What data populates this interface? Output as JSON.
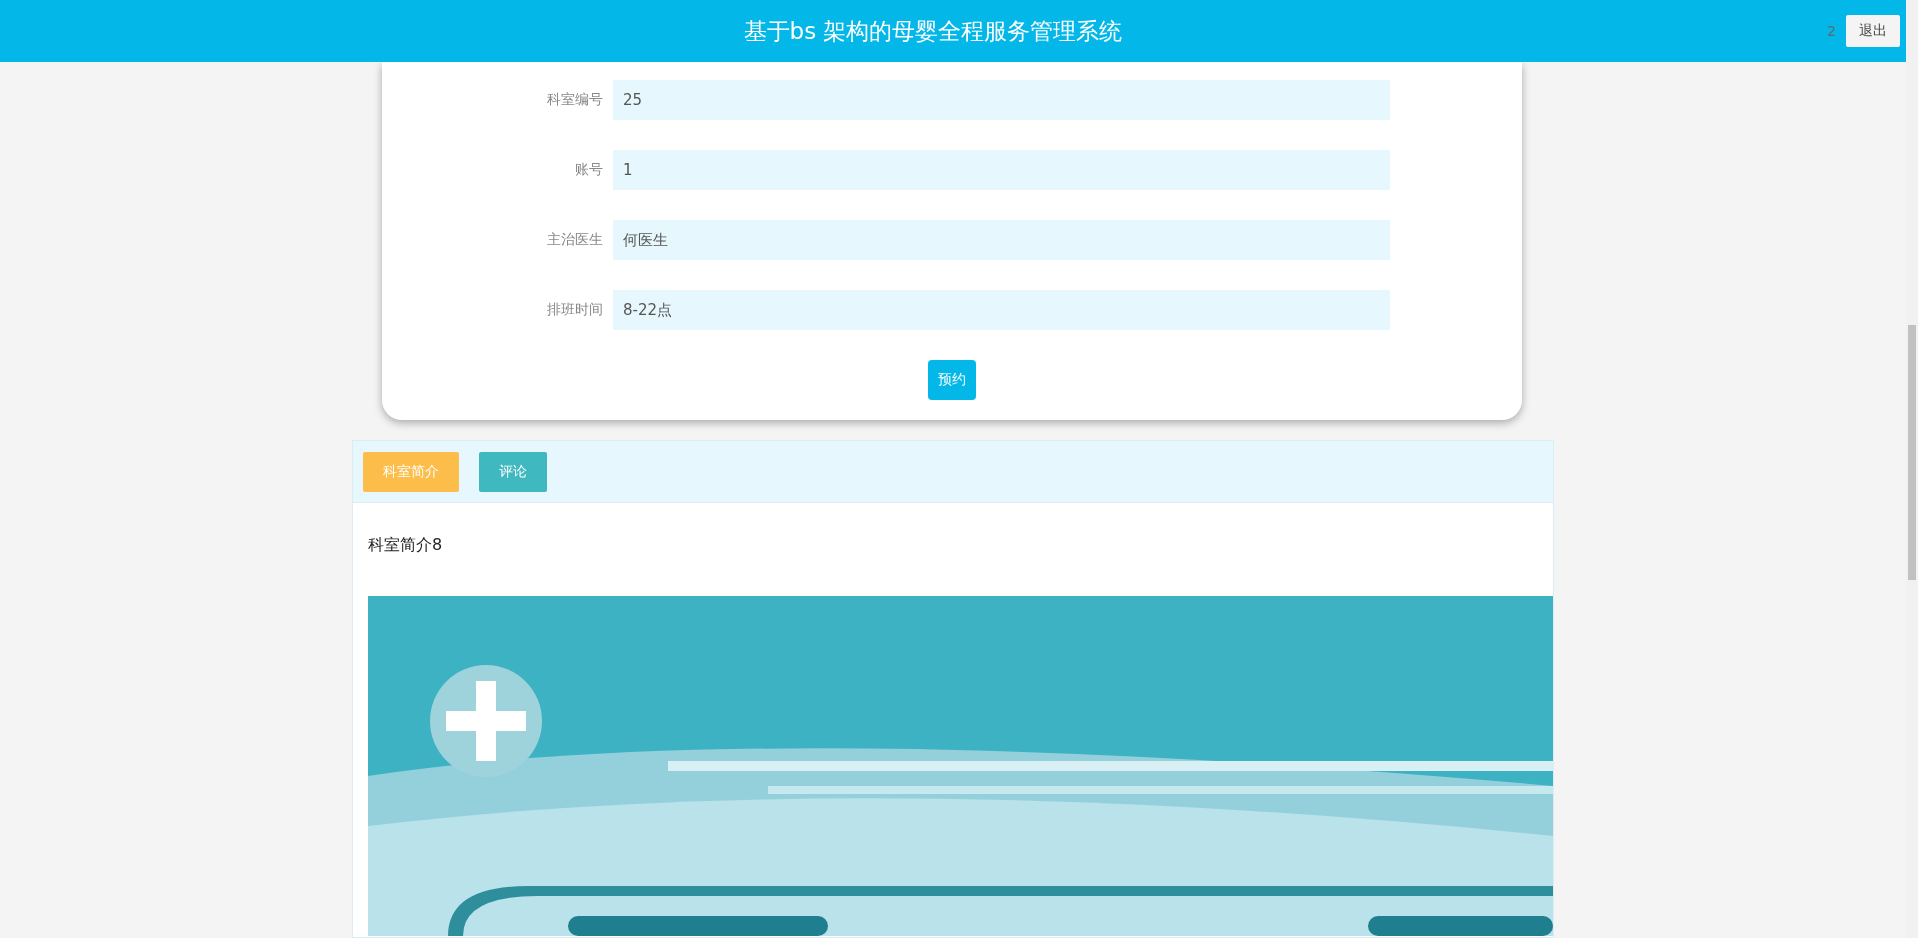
{
  "header": {
    "title": "基于bs 架构的母婴全程服务管理系统",
    "user": "2",
    "logout": "退出"
  },
  "form": {
    "fields": [
      {
        "label": "科室编号",
        "value": "25"
      },
      {
        "label": "账号",
        "value": "1"
      },
      {
        "label": "主治医生",
        "value": "何医生"
      },
      {
        "label": "排班时间",
        "value": "8-22点"
      }
    ],
    "submit": "预约"
  },
  "tabs": [
    {
      "label": "科室简介",
      "selected": true
    },
    {
      "label": "评论",
      "selected": false
    }
  ],
  "content": {
    "text": "科室简介8"
  }
}
